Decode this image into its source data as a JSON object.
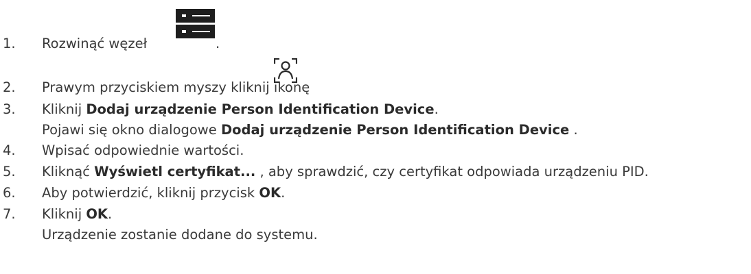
{
  "steps": [
    {
      "num": "1.",
      "text": "Rozwinąć węzeł",
      "after_icon": "."
    },
    {
      "num": "2.",
      "text": "Prawym przyciskiem myszy kliknij ikonę"
    },
    {
      "num": "3.",
      "pre": "Kliknij ",
      "bold": "Dodaj urządzenie Person Identification Device",
      "post": "."
    },
    {
      "cont_pre": "Pojawi się okno dialogowe ",
      "cont_bold": "Dodaj urządzenie Person Identification Device",
      "cont_post": " ."
    },
    {
      "num": "4.",
      "text": "Wpisać odpowiednie wartości."
    },
    {
      "num": "5.",
      "pre": "Kliknąć ",
      "bold": "Wyświetl certyfikat...",
      "post": " , aby sprawdzić, czy certyfikat odpowiada urządzeniu PID."
    },
    {
      "num": "6.",
      "pre": "Aby potwierdzić, kliknij przycisk ",
      "bold": "OK",
      "post": "."
    },
    {
      "num": "7.",
      "pre": "Kliknij ",
      "bold": "OK",
      "post": "."
    },
    {
      "cont_text": "Urządzenie zostanie dodane do systemu."
    }
  ],
  "icons": {
    "tree_icon": "device-tree-icon",
    "person_icon": "person-identification-icon",
    "tree_icon_color": "#1e1e1e"
  }
}
